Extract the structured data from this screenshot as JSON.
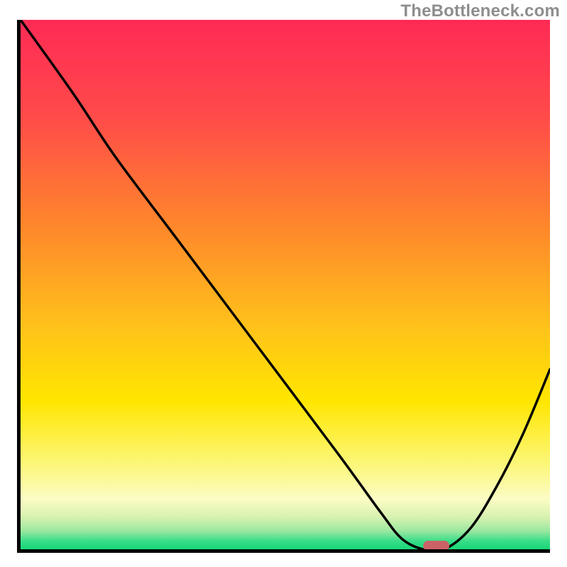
{
  "watermark": "TheBottleneck.com",
  "chart_data": {
    "type": "line",
    "title": "",
    "xlabel": "",
    "ylabel": "",
    "xlim": [
      0,
      100
    ],
    "ylim": [
      0,
      100
    ],
    "grid": false,
    "series": [
      {
        "name": "curve",
        "x": [
          0,
          10,
          18,
          30,
          45,
          60,
          68,
          72,
          76,
          80,
          85,
          90,
          95,
          100
        ],
        "y": [
          100,
          86,
          74,
          58,
          38,
          18,
          7,
          2,
          0,
          0,
          4,
          12,
          22,
          34
        ]
      }
    ],
    "marker": {
      "x_center": 78,
      "y": 0,
      "width_pct": 5
    },
    "gradient_stops": [
      {
        "offset": 0.0,
        "color": "#ff2a55"
      },
      {
        "offset": 0.18,
        "color": "#ff4a4a"
      },
      {
        "offset": 0.4,
        "color": "#ff8a2a"
      },
      {
        "offset": 0.58,
        "color": "#ffc21a"
      },
      {
        "offset": 0.72,
        "color": "#ffe600"
      },
      {
        "offset": 0.84,
        "color": "#fcf77a"
      },
      {
        "offset": 0.905,
        "color": "#fbfcc4"
      },
      {
        "offset": 0.94,
        "color": "#d6f2b0"
      },
      {
        "offset": 0.965,
        "color": "#9be8a0"
      },
      {
        "offset": 0.985,
        "color": "#37dd89"
      },
      {
        "offset": 1.0,
        "color": "#17d877"
      }
    ]
  }
}
